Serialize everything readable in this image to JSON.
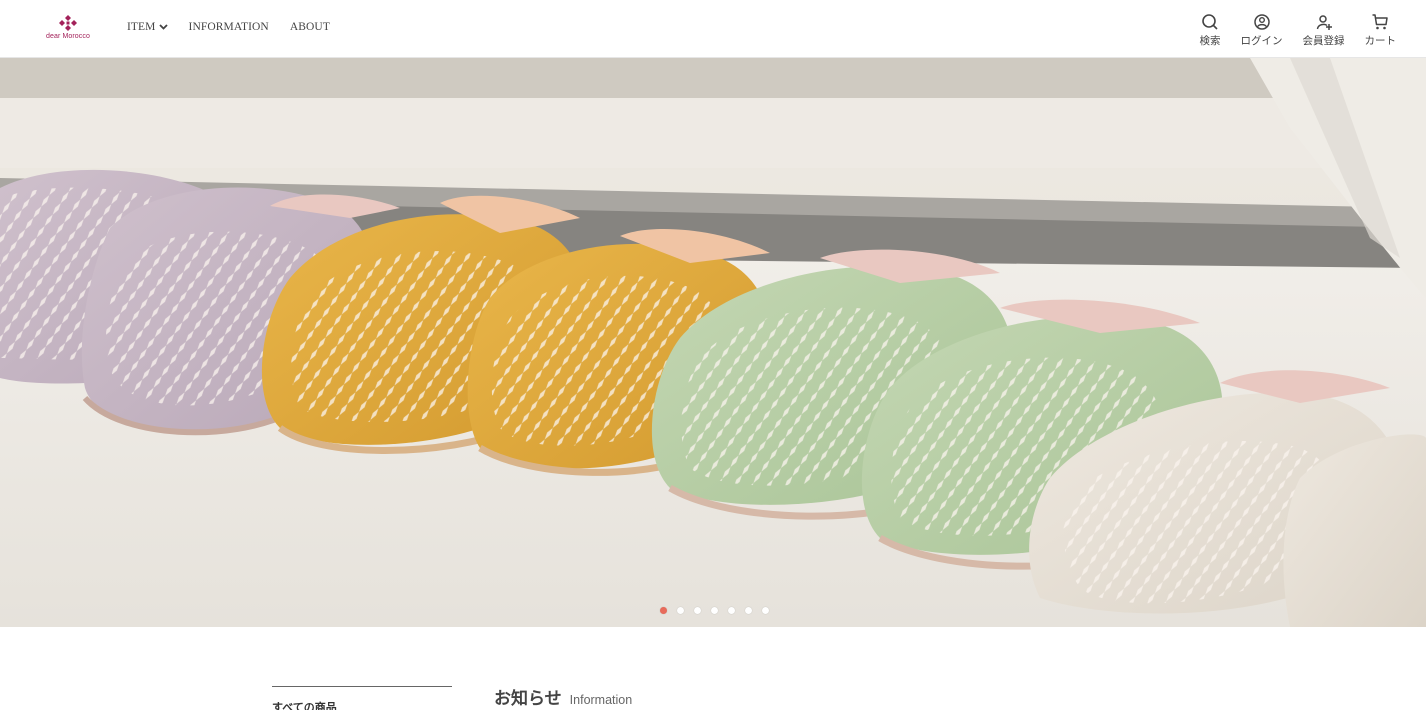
{
  "header": {
    "logo_text": "dear Morocco",
    "nav": [
      {
        "label": "ITEM",
        "has_dropdown": true
      },
      {
        "label": "INFORMATION"
      },
      {
        "label": "ABOUT"
      }
    ],
    "actions": [
      {
        "label": "検索",
        "icon": "search-icon"
      },
      {
        "label": "ログイン",
        "icon": "user-circle-icon"
      },
      {
        "label": "会員登録",
        "icon": "user-add-icon"
      },
      {
        "label": "カート",
        "icon": "cart-icon"
      }
    ]
  },
  "hero": {
    "slide_count": 7,
    "active_slide": 1,
    "accent_color": "#e86b5b"
  },
  "sidebar": {
    "first_link": "すべての商品"
  },
  "news": {
    "title": "お知らせ",
    "subtitle": "Information"
  },
  "colors": {
    "brand": "#a3225a",
    "text": "#444444"
  }
}
